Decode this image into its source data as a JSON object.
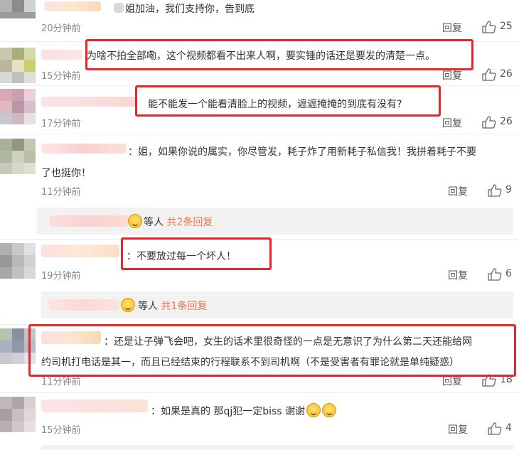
{
  "comments": [
    {
      "text": "姐加油，我们支持你，告到底",
      "time": "20分钟前",
      "reply": "回复",
      "likes": "25"
    },
    {
      "text": "为啥不拍全部嘞，这个视频都看不出来人啊，要实锤的话还是要发的清楚一点。",
      "time": "15分钟前",
      "reply": "回复",
      "likes": "26"
    },
    {
      "text": "能不能发一个能看清脸上的视频，遮遮掩掩的到底有没有?",
      "time": "17分钟前",
      "reply": "回复",
      "likes": "26"
    },
    {
      "text_line1": "：姐，如果你说的属实，你尽管发，耗子炸了用新耗子私信我！我拼着耗子不要",
      "text_line2": "了也挺你！",
      "time": "11分钟前",
      "reply": "回复",
      "likes": "9",
      "sub": {
        "who": "等人",
        "count": "共2条回复"
      }
    },
    {
      "text": "：不要放过每一个坏人！",
      "time": "19分钟前",
      "reply": "回复",
      "likes": "6",
      "sub": {
        "who": "等人",
        "count": "共1条回复"
      }
    },
    {
      "text_line1": "：还是让子弹飞会吧，女生的话术里很奇怪的一点是无意识了为什么第二天还能给网",
      "text_line2": "约司机打电话是其一，而且已经结束的行程联系不到司机啊（不是受害者有罪论就是单纯疑惑）",
      "time": "11分钟前",
      "reply": "回复",
      "likes": "18"
    },
    {
      "text": "：如果是真的 那qj犯一定biss 谢谢",
      "time": "15分钟前",
      "reply": "回复",
      "likes": "4"
    }
  ],
  "colors": {
    "highlight": "#e8262a",
    "sub_count": "#eb7350"
  },
  "icons": {
    "like": "thumbs-up-icon",
    "emoji": "smile-emoji-icon"
  }
}
